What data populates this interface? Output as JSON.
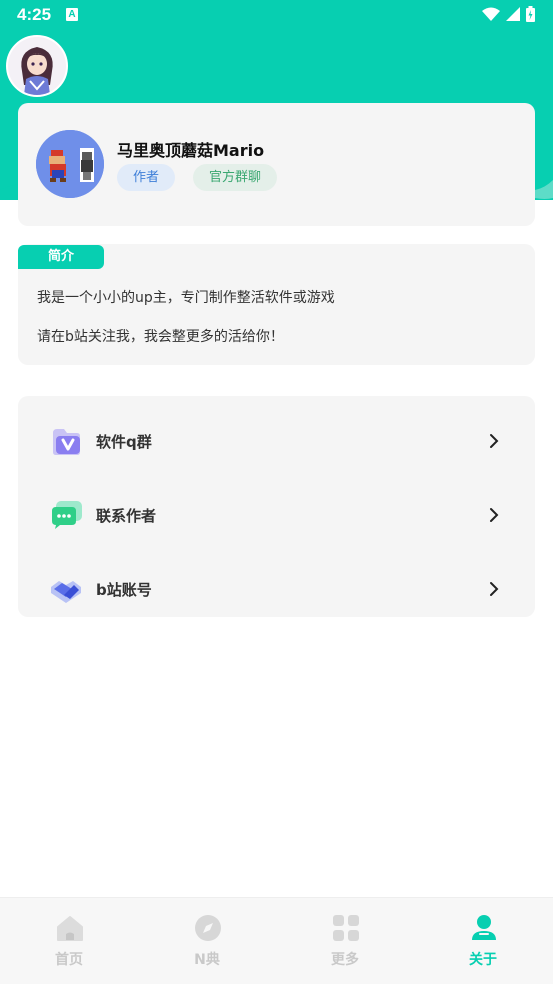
{
  "status_bar": {
    "time": "4:25",
    "notif_letter": "A"
  },
  "profile": {
    "name": "马里奥顶蘑菇Mario",
    "badge_author": "作者",
    "badge_group": "官方群聊"
  },
  "intro": {
    "tag": "简介",
    "line1": "我是一个小小的up主，专门制作整活软件或游戏",
    "line2": "请在b站关注我，我会整更多的活给你！"
  },
  "links": [
    {
      "label": "软件q群",
      "icon": "v-box-icon"
    },
    {
      "label": "联系作者",
      "icon": "chat-bubble-icon"
    },
    {
      "label": "b站账号",
      "icon": "handshake-icon"
    }
  ],
  "nav": [
    {
      "label": "首页",
      "icon": "home-icon"
    },
    {
      "label": "N典",
      "icon": "compass-icon"
    },
    {
      "label": "更多",
      "icon": "grid-icon"
    },
    {
      "label": "关于",
      "icon": "person-icon",
      "active": true
    }
  ],
  "colors": {
    "accent": "#07cfb1",
    "card_bg": "#f5f5f5",
    "nav_inactive": "#c9c9c9"
  }
}
